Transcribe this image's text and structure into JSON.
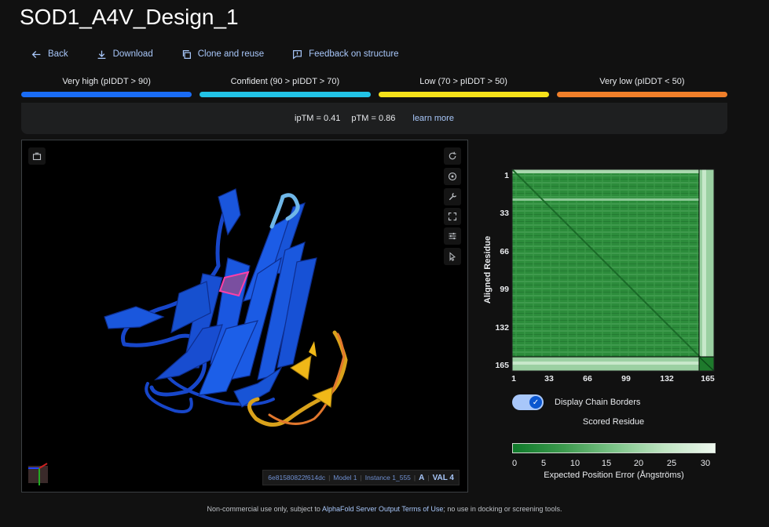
{
  "title": "SOD1_A4V_Design_1",
  "toolbar": {
    "back": "Back",
    "download": "Download",
    "clone": "Clone and reuse",
    "feedback": "Feedback on structure"
  },
  "legend": [
    {
      "label": "Very high (pIDDT > 90)",
      "color": "#1a6cf5"
    },
    {
      "label": "Confident (90 > pIDDT > 70)",
      "color": "#22c3e6"
    },
    {
      "label": "Low (70 > pIDDT > 50)",
      "color": "#f5e11a"
    },
    {
      "label": "Very low (pIDDT < 50)",
      "color": "#f07f2a"
    }
  ],
  "metrics": {
    "iptm": "ipTM = 0.41",
    "ptm": "pTM = 0.86",
    "learn_more": "learn more"
  },
  "viewer": {
    "status_id": "6e81580822f614dc",
    "status_model": "Model 1",
    "status_instance": "Instance 1_555",
    "status_chain": "A",
    "status_residue": "VAL 4"
  },
  "pae": {
    "y_label": "Aligned Residue",
    "x_label": "Scored Residue",
    "y_ticks": [
      "1",
      "33",
      "66",
      "99",
      "132",
      "165"
    ],
    "x_ticks": [
      "1",
      "33",
      "66",
      "99",
      "132",
      "165"
    ],
    "toggle_label": "Display Chain Borders",
    "colorbar_ticks": [
      "0",
      "5",
      "10",
      "15",
      "20",
      "25",
      "30"
    ],
    "colorbar_label": "Expected Position Error (Ångströms)"
  },
  "footer": {
    "prefix": "Non-commercial use only, subject to ",
    "link": "AlphaFold Server Output Terms of Use",
    "suffix": "; no use in docking or screening tools."
  }
}
